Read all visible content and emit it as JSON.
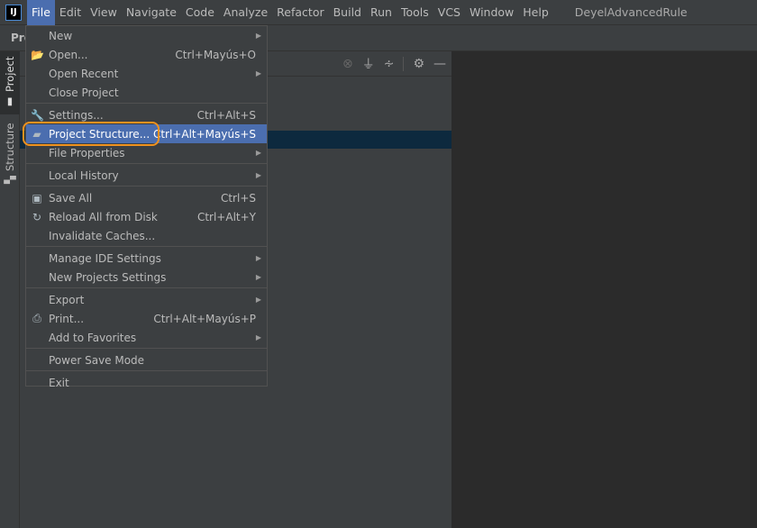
{
  "app": {
    "logo": "IJ",
    "title": "DeyelAdvancedRule"
  },
  "menubar": [
    "File",
    "Edit",
    "View",
    "Navigate",
    "Code",
    "Analyze",
    "Refactor",
    "Build",
    "Run",
    "Tools",
    "VCS",
    "Window",
    "Help"
  ],
  "navbar": {
    "label": "Pro"
  },
  "sidebar": {
    "tabs": [
      {
        "label": "Project",
        "icon": "folder-icon"
      },
      {
        "label": "Structure",
        "icon": "structure-icon"
      }
    ]
  },
  "panel_tools": [
    "locate-icon",
    "expand-all-icon",
    "collapse-all-icon",
    "gear-icon",
    "minimize-icon"
  ],
  "file_menu": {
    "groups": [
      [
        {
          "label": "New",
          "submenu": true
        },
        {
          "label": "Open...",
          "shortcut": "Ctrl+Mayús+O",
          "icon": "folder-open-icon"
        },
        {
          "label": "Open Recent",
          "submenu": true
        },
        {
          "label": "Close Project"
        }
      ],
      [
        {
          "label": "Settings...",
          "shortcut": "Ctrl+Alt+S",
          "icon": "wrench-icon"
        },
        {
          "label": "Project Structure...",
          "shortcut": "Ctrl+Alt+Mayús+S",
          "icon": "project-structure-icon",
          "highlighted": true
        },
        {
          "label": "File Properties",
          "submenu": true
        }
      ],
      [
        {
          "label": "Local History",
          "submenu": true
        }
      ],
      [
        {
          "label": "Save All",
          "shortcut": "Ctrl+S",
          "icon": "save-icon"
        },
        {
          "label": "Reload All from Disk",
          "shortcut": "Ctrl+Alt+Y",
          "icon": "reload-icon"
        },
        {
          "label": "Invalidate Caches..."
        }
      ],
      [
        {
          "label": "Manage IDE Settings",
          "submenu": true
        },
        {
          "label": "New Projects Settings",
          "submenu": true
        }
      ],
      [
        {
          "label": "Export",
          "submenu": true
        },
        {
          "label": "Print...",
          "shortcut": "Ctrl+Alt+Mayús+P",
          "icon": "print-icon"
        },
        {
          "label": "Add to Favorites",
          "submenu": true
        }
      ],
      [
        {
          "label": "Power Save Mode"
        }
      ],
      [
        {
          "label": "Exit"
        }
      ]
    ]
  },
  "colors": {
    "highlight": "#4b6eaf",
    "focus_ring": "#f0921e",
    "selection": "#0d293e"
  }
}
